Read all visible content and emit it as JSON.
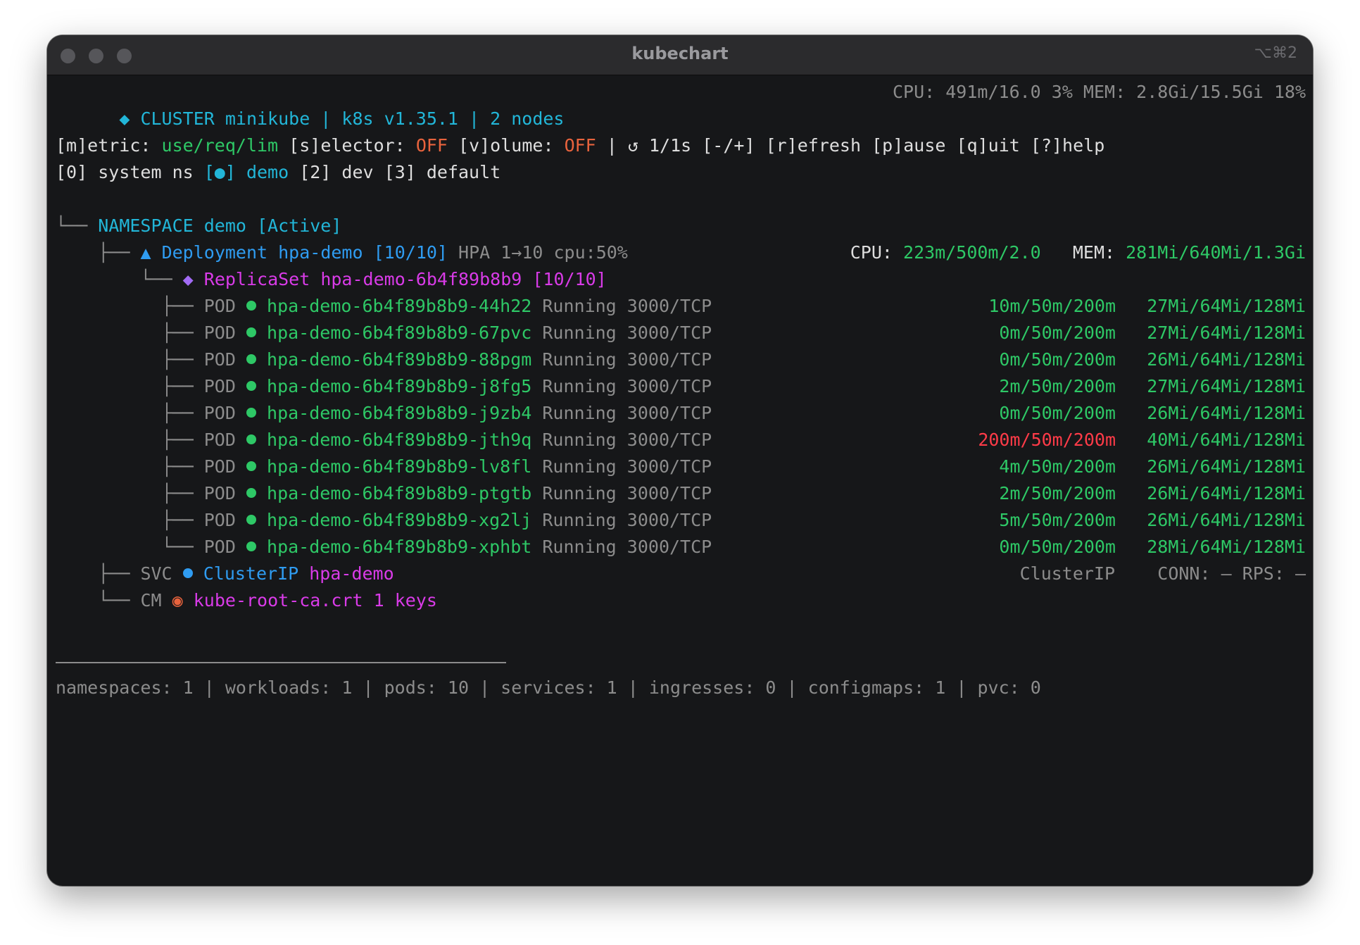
{
  "window": {
    "title": "kubechart",
    "shortcut": "⌥⌘2"
  },
  "header": {
    "cluster_icon": "◆",
    "cluster_text": "CLUSTER minikube | k8s v1.35.1 | 2 nodes",
    "resources": "CPU: 491m/16.0 3% MEM: 2.8Gi/15.5Gi 18%"
  },
  "controls": {
    "metric_key": "[m]etric:",
    "metric_value": "use/req/lim",
    "selector_key": "[s]elector:",
    "selector_value": "OFF",
    "volume_key": "[v]olume:",
    "volume_value": "OFF",
    "interval": "| ↺ 1/1s [-/+]",
    "refresh": "[r]efresh",
    "pause": "[p]ause",
    "quit": "[q]uit",
    "help": "[?]help"
  },
  "ns_tabs": [
    {
      "label": "[0] system ns",
      "active": false
    },
    {
      "label": "[●] demo",
      "active": true
    },
    {
      "label": "[2] dev",
      "active": false
    },
    {
      "label": "[3] default",
      "active": false
    }
  ],
  "namespace": {
    "branch": "└──",
    "label": "NAMESPACE demo [Active]"
  },
  "deployment": {
    "branch": "├──",
    "icon": "▲",
    "label": "Deployment hpa-demo",
    "count": "[10/10]",
    "hpa": "HPA 1→10 cpu:50%",
    "cpu_label": "CPU:",
    "cpu_value": "223m/500m/2.0",
    "mem_label": "MEM:",
    "mem_value": "281Mi/640Mi/1.3Gi"
  },
  "replicaset": {
    "branch": "└──",
    "icon": "◆",
    "label": "ReplicaSet hpa-demo-6b4f89b8b9 [10/10]"
  },
  "pods": [
    {
      "branch": "├──",
      "kind": "POD",
      "name": "hpa-demo-6b4f89b8b9-44h22",
      "status": "Running",
      "port": "3000/TCP",
      "cpu": "10m/50m/200m",
      "cpu_color": "#2ec866",
      "mem": "27Mi/64Mi/128Mi"
    },
    {
      "branch": "├──",
      "kind": "POD",
      "name": "hpa-demo-6b4f89b8b9-67pvc",
      "status": "Running",
      "port": "3000/TCP",
      "cpu": "0m/50m/200m",
      "cpu_color": "#2ec866",
      "mem": "27Mi/64Mi/128Mi"
    },
    {
      "branch": "├──",
      "kind": "POD",
      "name": "hpa-demo-6b4f89b8b9-88pgm",
      "status": "Running",
      "port": "3000/TCP",
      "cpu": "0m/50m/200m",
      "cpu_color": "#2ec866",
      "mem": "26Mi/64Mi/128Mi"
    },
    {
      "branch": "├──",
      "kind": "POD",
      "name": "hpa-demo-6b4f89b8b9-j8fg5",
      "status": "Running",
      "port": "3000/TCP",
      "cpu": "2m/50m/200m",
      "cpu_color": "#2ec866",
      "mem": "27Mi/64Mi/128Mi"
    },
    {
      "branch": "├──",
      "kind": "POD",
      "name": "hpa-demo-6b4f89b8b9-j9zb4",
      "status": "Running",
      "port": "3000/TCP",
      "cpu": "0m/50m/200m",
      "cpu_color": "#2ec866",
      "mem": "26Mi/64Mi/128Mi"
    },
    {
      "branch": "├──",
      "kind": "POD",
      "name": "hpa-demo-6b4f89b8b9-jth9q",
      "status": "Running",
      "port": "3000/TCP",
      "cpu": "200m/50m/200m",
      "cpu_color": "#ff3b48",
      "mem": "40Mi/64Mi/128Mi"
    },
    {
      "branch": "├──",
      "kind": "POD",
      "name": "hpa-demo-6b4f89b8b9-lv8fl",
      "status": "Running",
      "port": "3000/TCP",
      "cpu": "4m/50m/200m",
      "cpu_color": "#2ec866",
      "mem": "26Mi/64Mi/128Mi"
    },
    {
      "branch": "├──",
      "kind": "POD",
      "name": "hpa-demo-6b4f89b8b9-ptgtb",
      "status": "Running",
      "port": "3000/TCP",
      "cpu": "2m/50m/200m",
      "cpu_color": "#2ec866",
      "mem": "26Mi/64Mi/128Mi"
    },
    {
      "branch": "├──",
      "kind": "POD",
      "name": "hpa-demo-6b4f89b8b9-xg2lj",
      "status": "Running",
      "port": "3000/TCP",
      "cpu": "5m/50m/200m",
      "cpu_color": "#2ec866",
      "mem": "26Mi/64Mi/128Mi"
    },
    {
      "branch": "└──",
      "kind": "POD",
      "name": "hpa-demo-6b4f89b8b9-xphbt",
      "status": "Running",
      "port": "3000/TCP",
      "cpu": "0m/50m/200m",
      "cpu_color": "#2ec866",
      "mem": "28Mi/64Mi/128Mi"
    }
  ],
  "service": {
    "branch": "├──",
    "kind": "SVC",
    "type": "ClusterIP",
    "name": "hpa-demo",
    "type_right": "ClusterIP",
    "conn": "CONN: — RPS: —"
  },
  "configmap": {
    "branch": "└──",
    "kind": "CM",
    "name": "kube-root-ca.crt 1 keys"
  },
  "footer": "namespaces: 1 | workloads: 1 | pods: 10 | services: 1 | ingresses: 0 | configmaps: 1 | pvc: 0",
  "colors": {
    "background": "#161719",
    "cyan": "#22b6d8",
    "blue": "#2f9cf1",
    "green": "#2ec866",
    "orange": "#e8633d",
    "magenta": "#d93be8",
    "red": "#ff3b48",
    "gray": "#8c8c8c"
  }
}
